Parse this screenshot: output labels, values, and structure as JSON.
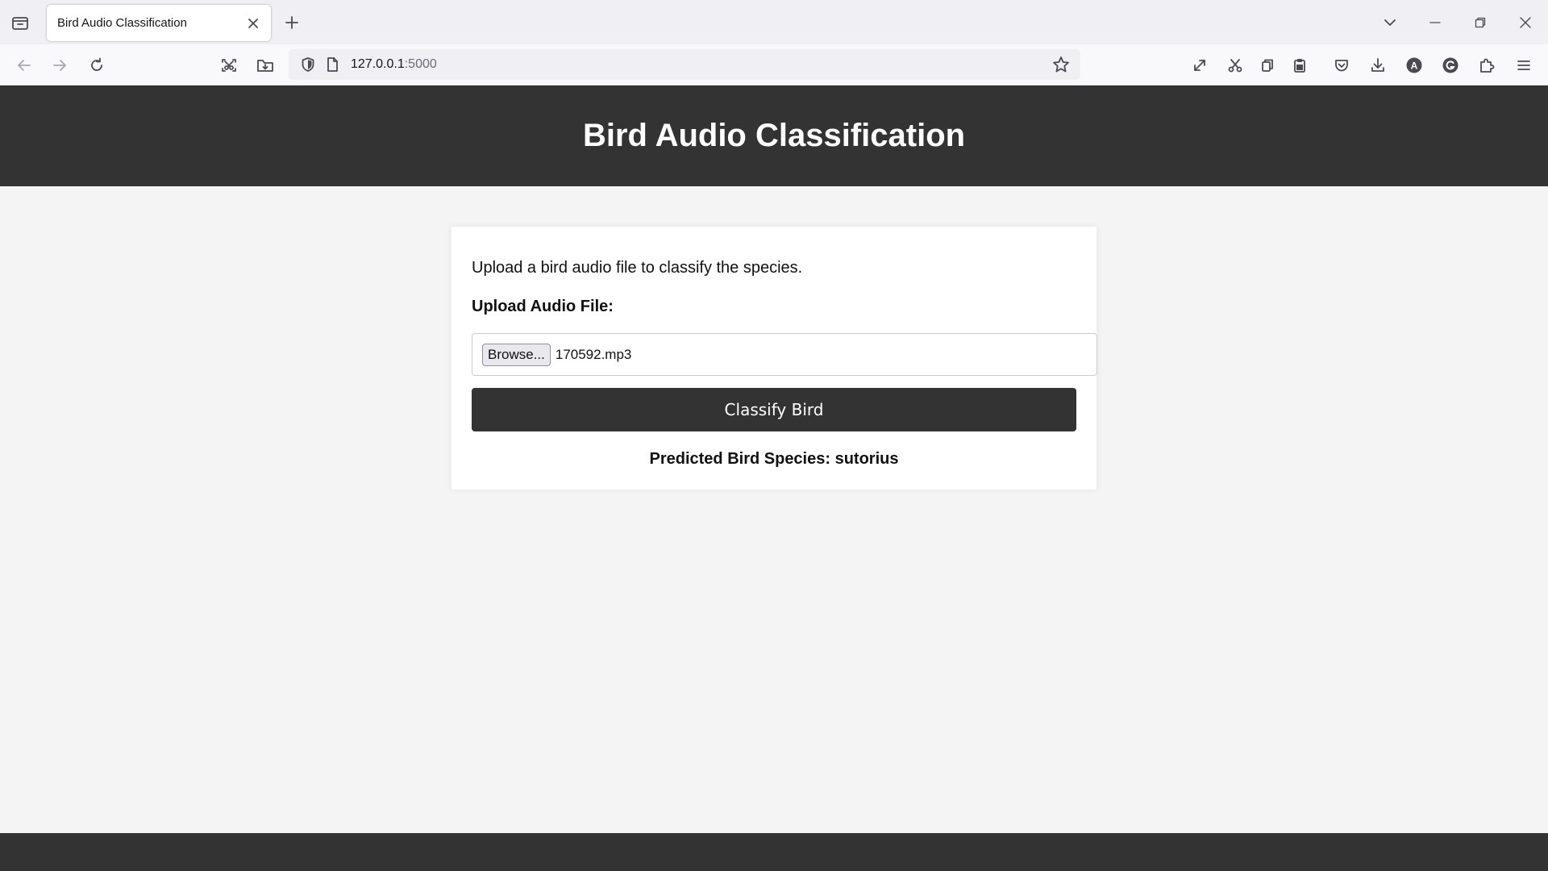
{
  "browser": {
    "tab_title": "Bird Audio Classification",
    "url_host": "127.0.0.1",
    "url_port": ":5000",
    "icons": {
      "tab_list": "tab-list-icon",
      "tab_close": "close-icon",
      "new_tab": "plus-icon",
      "list_all_tabs": "chevron-down-icon",
      "minimize": "minimize-icon",
      "restore": "restore-icon",
      "close_window": "close-icon",
      "back": "back-arrow-icon",
      "forward": "forward-arrow-icon",
      "reload": "reload-icon",
      "screenshot": "screenshot-icon",
      "save_to_pocket_folder": "folder-download-icon",
      "tracking_protection": "shield-icon",
      "page_info": "page-icon",
      "bookmark": "star-icon",
      "fullscreen": "expand-icon",
      "cut": "scissors-icon",
      "copy": "copy-icon",
      "paste": "clipboard-icon",
      "pocket": "pocket-icon",
      "downloads": "download-icon",
      "account": "account-icon",
      "grammarly": "grammarly-icon",
      "extensions": "puzzle-icon",
      "menu": "hamburger-menu-icon"
    }
  },
  "page": {
    "title": "Bird Audio Classification",
    "intro": "Upload a bird audio file to classify the species.",
    "upload_label": "Upload Audio File:",
    "browse_label": "Browse...",
    "file_name": "170592.mp3",
    "classify_label": "Classify Bird",
    "prediction": "Predicted Bird Species: sutorius"
  },
  "colors": {
    "header_bg": "#333333",
    "button_bg": "#333333",
    "page_bg": "#f4f4f4",
    "card_bg": "#ffffff"
  }
}
